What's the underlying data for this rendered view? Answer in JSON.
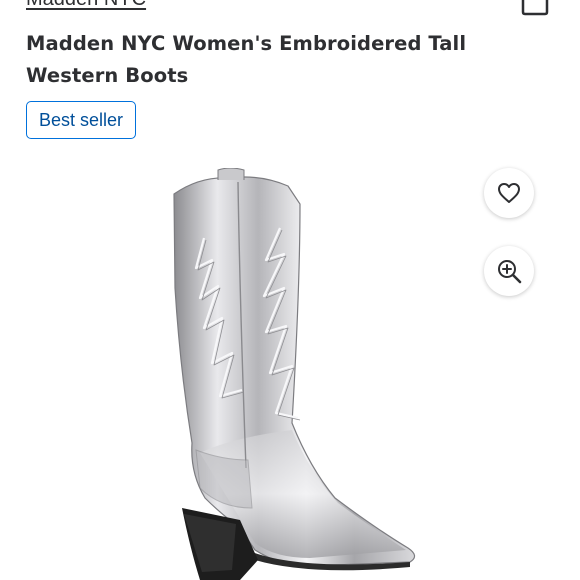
{
  "product": {
    "brand": "Madden NYC",
    "title": "Madden NYC Women's Embroidered Tall Western Boots",
    "badge": "Best seller"
  },
  "icons": {
    "cart": "shopping-bag-icon",
    "favorite": "heart-icon",
    "zoom": "zoom-in-icon"
  },
  "colors": {
    "badge_border": "#0071dc",
    "badge_text": "#004f9a",
    "text": "#2e2f32"
  }
}
